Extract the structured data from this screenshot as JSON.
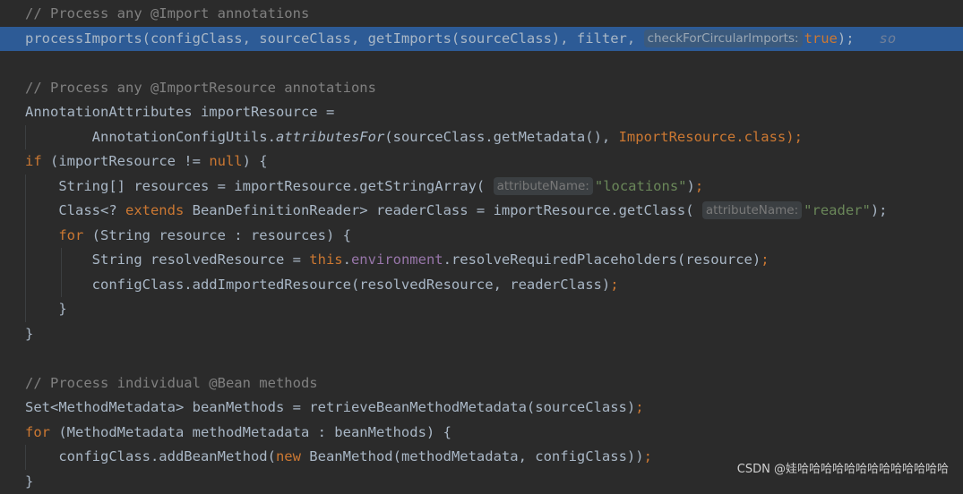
{
  "lines": [
    {
      "tokens": [
        {
          "t": "// Process any @Import annotations",
          "c": "c-comment"
        }
      ]
    },
    {
      "highlight": true,
      "tokens": [
        {
          "t": "processImports(configClass, sourceClass, getImports(sourceClass), filter, "
        },
        {
          "hint": "checkForCircularImports:"
        },
        {
          "t": "true",
          "c": "c-kw"
        },
        {
          "t": ");"
        },
        {
          "t": "   so",
          "c": "faded"
        }
      ]
    },
    {
      "tokens": []
    },
    {
      "tokens": [
        {
          "t": "// Process any @ImportResource annotations",
          "c": "c-comment"
        }
      ]
    },
    {
      "tokens": [
        {
          "t": "AnnotationAttributes importResource ="
        }
      ]
    },
    {
      "guides": [
        1
      ],
      "tokens": [
        {
          "t": "        AnnotationConfigUtils."
        },
        {
          "t": "attributesFor",
          "c": "c-italic"
        },
        {
          "t": "(sourceClass.getMetadata(), "
        },
        {
          "t": "ImportResource.",
          "c": "c-class"
        },
        {
          "t": "class",
          "c": "c-kw"
        },
        {
          "t": ");",
          "c": "c-kw"
        }
      ]
    },
    {
      "tokens": [
        {
          "t": "if",
          "c": "c-kw"
        },
        {
          "t": " (importResource != "
        },
        {
          "t": "null",
          "c": "c-kw"
        },
        {
          "t": ") {"
        }
      ]
    },
    {
      "guides": [
        1
      ],
      "tokens": [
        {
          "t": "    String[] resources = importResource.getStringArray( "
        },
        {
          "hint": "attributeName:"
        },
        {
          "t": "\"locations\"",
          "c": "c-str"
        },
        {
          "t": ")"
        },
        {
          "t": ";",
          "c": "c-kw"
        }
      ]
    },
    {
      "guides": [
        1
      ],
      "tokens": [
        {
          "t": "    Class<? "
        },
        {
          "t": "extends",
          "c": "c-kw"
        },
        {
          "t": " BeanDefinitionReader> readerClass = importResource.getClass( "
        },
        {
          "hint": "attributeName:"
        },
        {
          "t": "\"reader\"",
          "c": "c-str"
        },
        {
          "t": ");"
        }
      ]
    },
    {
      "guides": [
        1
      ],
      "tokens": [
        {
          "t": "    "
        },
        {
          "t": "for",
          "c": "c-kw"
        },
        {
          "t": " (String resource : resources) {"
        }
      ]
    },
    {
      "guides": [
        1,
        2
      ],
      "tokens": [
        {
          "t": "        String resolvedResource = "
        },
        {
          "t": "this",
          "c": "c-kw"
        },
        {
          "t": "."
        },
        {
          "t": "environment",
          "c": "c-field"
        },
        {
          "t": ".resolveRequiredPlaceholders(resource)"
        },
        {
          "t": ";",
          "c": "c-kw"
        }
      ]
    },
    {
      "guides": [
        1,
        2
      ],
      "tokens": [
        {
          "t": "        configClass.addImportedResource(resolvedResource, readerClass)"
        },
        {
          "t": ";",
          "c": "c-kw"
        }
      ]
    },
    {
      "guides": [
        1
      ],
      "tokens": [
        {
          "t": "    }"
        }
      ]
    },
    {
      "tokens": [
        {
          "t": "}"
        }
      ]
    },
    {
      "tokens": []
    },
    {
      "tokens": [
        {
          "t": "// Process individual @Bean methods",
          "c": "c-comment"
        }
      ]
    },
    {
      "tokens": [
        {
          "t": "Set<MethodMetadata> beanMethods = retrieveBeanMethodMetadata(sourceClass)"
        },
        {
          "t": ";",
          "c": "c-kw"
        }
      ]
    },
    {
      "tokens": [
        {
          "t": "for",
          "c": "c-kw"
        },
        {
          "t": " (MethodMetadata methodMetadata : beanMethods) {"
        }
      ]
    },
    {
      "guides": [
        1
      ],
      "tokens": [
        {
          "t": "    configClass.addBeanMethod("
        },
        {
          "t": "new",
          "c": "c-kw"
        },
        {
          "t": " BeanMethod(methodMetadata, configClass))"
        },
        {
          "t": ";",
          "c": "c-kw"
        }
      ]
    },
    {
      "tokens": [
        {
          "t": "}"
        }
      ]
    }
  ],
  "watermark": "CSDN @娃哈哈哈哈哈哈哈哈哈哈哈哈哈"
}
